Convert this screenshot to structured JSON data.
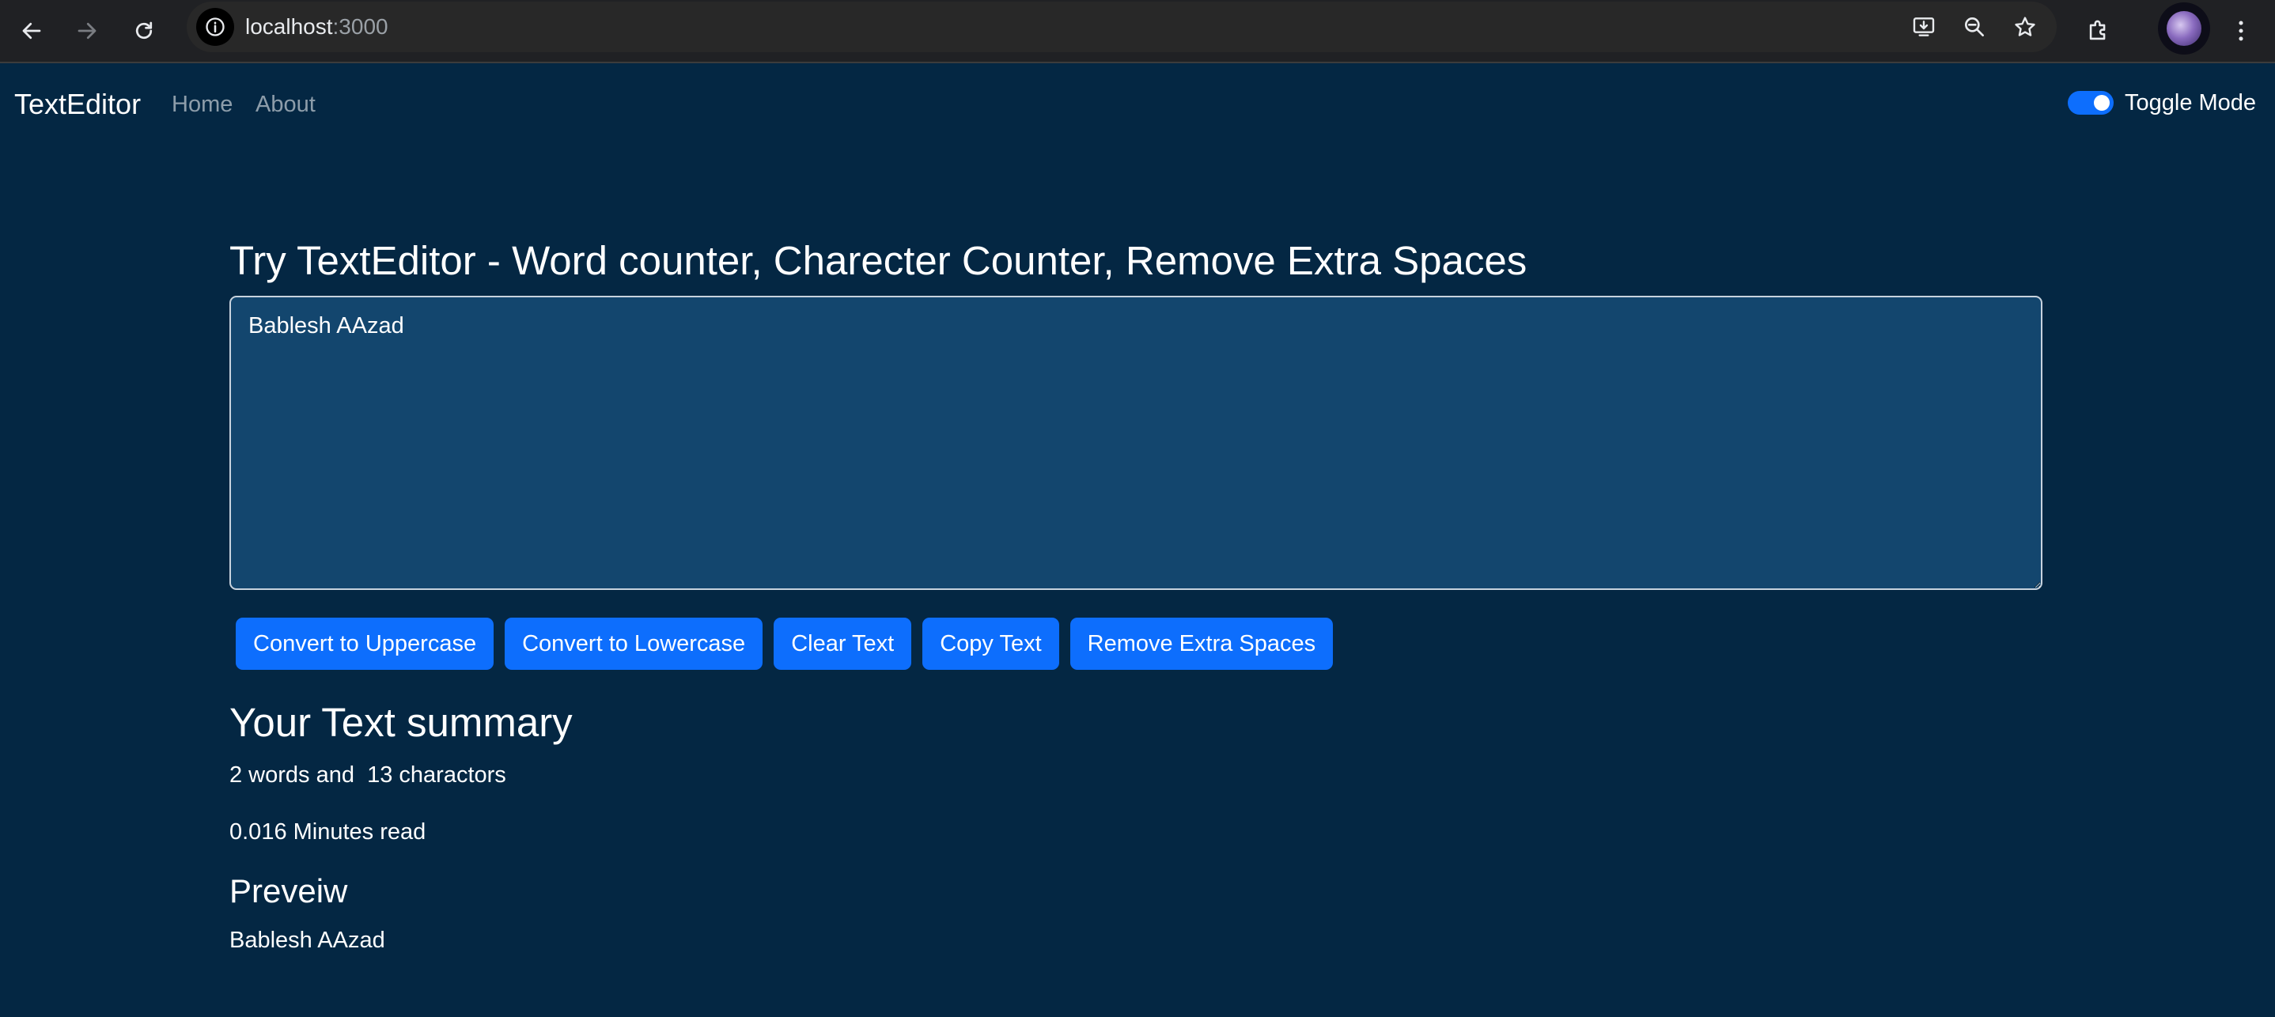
{
  "browser": {
    "url_host": "localhost",
    "url_port": ":3000",
    "icons": {
      "back": "arrow-left-icon",
      "forward": "arrow-right-icon",
      "reload": "reload-icon",
      "site_info": "info-icon",
      "install": "install-app-icon",
      "zoom": "zoom-out-icon",
      "bookmark": "star-icon",
      "extensions": "puzzle-icon",
      "menu": "kebab-menu-icon"
    }
  },
  "navbar": {
    "brand": "TextEditor",
    "links": [
      "Home",
      "About"
    ],
    "toggle_label": "Toggle Mode",
    "toggle_on": true
  },
  "main": {
    "heading": "Try TextEditor - Word counter, Charecter Counter, Remove Extra Spaces",
    "textarea_value": "Bablesh AAzad",
    "buttons": [
      "Convert to Uppercase",
      "Convert to Lowercase",
      "Clear Text",
      "Copy Text",
      "Remove Extra Spaces"
    ]
  },
  "summary": {
    "title": "Your Text summary",
    "counts": "2 words and  13 charactors",
    "read_time": "0.016 Minutes read"
  },
  "preview": {
    "title": "Preveiw",
    "text": "Bablesh AAzad"
  },
  "colors": {
    "page_background": "#042743",
    "textarea_background": "#13466e",
    "button_primary": "#0d6efd",
    "browser_chrome": "#202124"
  }
}
